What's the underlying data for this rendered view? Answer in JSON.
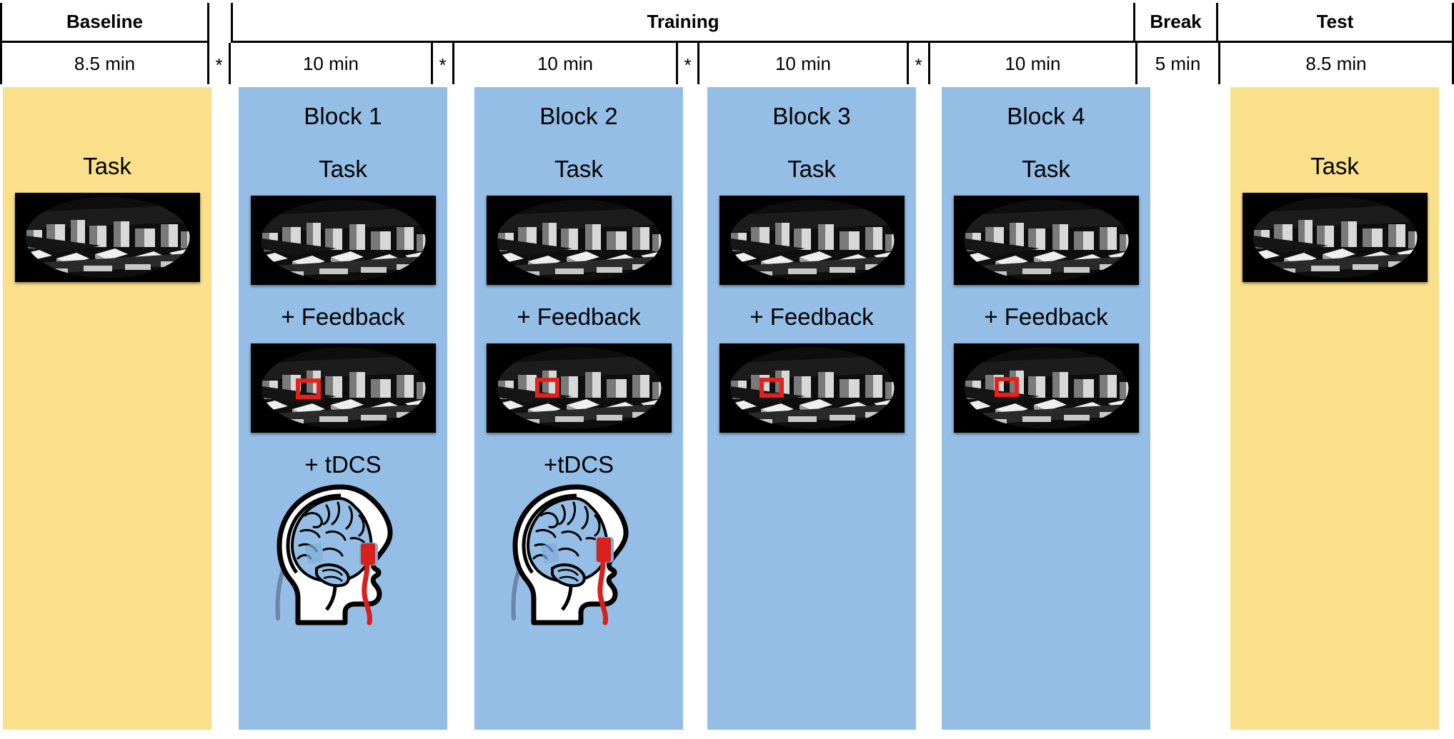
{
  "timeline": {
    "phases": [
      {
        "name": "Baseline",
        "duration": "8.5 min"
      },
      {
        "name": "Training",
        "duration": ""
      },
      {
        "name": "Break",
        "duration": "5 min"
      },
      {
        "name": "Test",
        "duration": "8.5 min"
      }
    ],
    "training_label": "Training",
    "training_durations": [
      "10 min",
      "10 min",
      "10 min",
      "10 min"
    ],
    "separator_marker": "*",
    "separator_count": 4,
    "baseline_label": "Baseline",
    "baseline_duration": "8.5 min",
    "break_label": "Break",
    "break_duration": "5 min",
    "test_label": "Test",
    "test_duration": "8.5 min"
  },
  "columns": [
    {
      "id": "baseline",
      "type": "session",
      "title": "",
      "task_label": "Task",
      "feedback_label": "",
      "tdcs_label": "",
      "has_task_image": true,
      "has_feedback_image": false,
      "has_head_figure": false,
      "bg": "#FBE08C"
    },
    {
      "id": "block-1",
      "type": "block",
      "title": "Block 1",
      "task_label": "Task",
      "feedback_label": "+ Feedback",
      "tdcs_label": "+ tDCS",
      "has_task_image": true,
      "has_feedback_image": true,
      "has_head_figure": true,
      "bg": "#94BEE6"
    },
    {
      "id": "block-2",
      "type": "block",
      "title": "Block 2",
      "task_label": "Task",
      "feedback_label": "+ Feedback",
      "tdcs_label": "+tDCS",
      "has_task_image": true,
      "has_feedback_image": true,
      "has_head_figure": true,
      "bg": "#94BEE6"
    },
    {
      "id": "block-3",
      "type": "block",
      "title": "Block 3",
      "task_label": "Task",
      "feedback_label": "+ Feedback",
      "tdcs_label": "",
      "has_task_image": true,
      "has_feedback_image": true,
      "has_head_figure": false,
      "bg": "#94BEE6"
    },
    {
      "id": "block-4",
      "type": "block",
      "title": "Block 4",
      "task_label": "Task",
      "feedback_label": "+ Feedback",
      "tdcs_label": "",
      "has_task_image": true,
      "has_feedback_image": true,
      "has_head_figure": false,
      "bg": "#94BEE6"
    },
    {
      "id": "test",
      "type": "session",
      "title": "",
      "task_label": "Task",
      "feedback_label": "",
      "tdcs_label": "",
      "has_task_image": true,
      "has_feedback_image": false,
      "has_head_figure": false,
      "bg": "#FBE08C"
    }
  ],
  "stimulus": {
    "description": "aerial grayscale city scene in elliptical vignette on black background",
    "background": "#000000",
    "feedback_box_color": "#E8201C"
  },
  "tdcs_figure": {
    "description": "lateral head profile with brain, red electrode pad and red cable",
    "electrode_color": "#D8201C",
    "cable_color": "#D8201C",
    "brain_color": "#94BEE6",
    "reference_cable_color": "#6E85A8"
  },
  "colors": {
    "session_bg": "#FBE08C",
    "block_bg": "#94BEE6",
    "page_bg": "#FFFFFF",
    "line": "#000000",
    "accent_red": "#E8201C"
  }
}
